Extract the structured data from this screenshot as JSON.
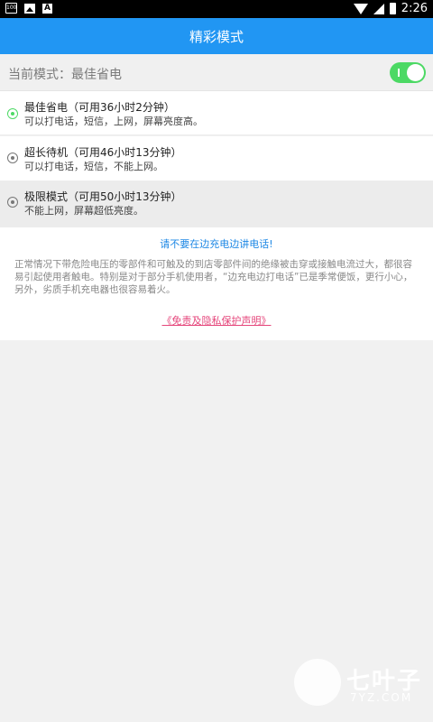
{
  "status_bar": {
    "battery_level_badge": "100",
    "notification_badge": "A",
    "time": "2:26"
  },
  "title_bar": {
    "title": "精彩模式"
  },
  "current_mode": {
    "label": "当前模式：最佳省电",
    "toggle_on": true,
    "toggle_color": "#4cd964"
  },
  "options": [
    {
      "title": "最佳省电（可用36小时2分钟）",
      "desc": "可以打电话，短信，上网，屏幕亮度高。",
      "selected": true
    },
    {
      "title": "超长待机（可用46小时13分钟）",
      "desc": "可以打电话，短信，不能上网。",
      "selected": false
    },
    {
      "title": "极限模式（可用50小时13分钟）",
      "desc": "不能上网，屏幕超低亮度。",
      "selected": false
    }
  ],
  "notice": {
    "warning": "请不要在边充电边讲电话!",
    "paragraph": "正常情况下带危险电压的零部件和可触及的到店零部件间的绝缘被击穿或接触电流过大，都很容易引起使用者触电。特别是对于部分手机使用者，“边充电边打电话”已是季常便饭，更行小心，另外，劣质手机充电器也很容易着火。",
    "disclaimer_link": "《免责及隐私保护声明》"
  },
  "watermark": {
    "name": "七叶子",
    "domain": "7YZ.COM"
  },
  "colors": {
    "accent": "#2196f3",
    "link": "#e5467b",
    "warning": "#1e88e5"
  }
}
